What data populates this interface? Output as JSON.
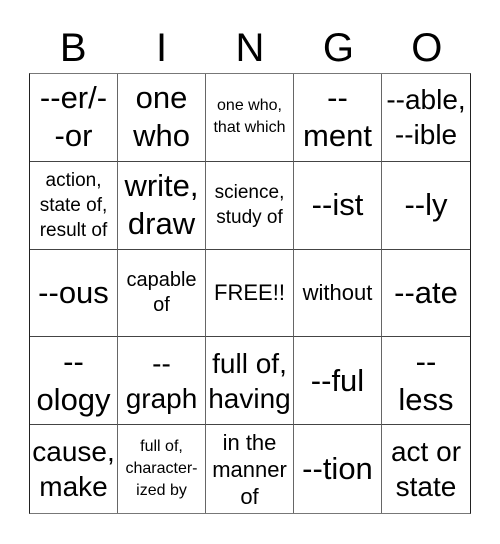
{
  "header": {
    "letters": [
      "B",
      "I",
      "N",
      "G",
      "O"
    ]
  },
  "cells": [
    {
      "text": "--er/-\n-or",
      "size": "s-xl"
    },
    {
      "text": "one\nwho",
      "size": "s-xl"
    },
    {
      "text": "one who,\nthat which",
      "size": "s-xs"
    },
    {
      "text": "--\nment",
      "size": "s-xl"
    },
    {
      "text": "--able,\n--ible",
      "size": "s-l"
    },
    {
      "text": "action,\nstate of,\nresult of",
      "size": "s-s"
    },
    {
      "text": "write,\ndraw",
      "size": "s-xl"
    },
    {
      "text": "science,\nstudy of",
      "size": "s-s"
    },
    {
      "text": "--ist",
      "size": "s-xl"
    },
    {
      "text": "--ly",
      "size": "s-xl"
    },
    {
      "text": "--ous",
      "size": "s-xl"
    },
    {
      "text": "capable\nof",
      "size": "s-ms"
    },
    {
      "text": "FREE!!",
      "size": "s-m"
    },
    {
      "text": "without",
      "size": "s-m"
    },
    {
      "text": "--ate",
      "size": "s-xl"
    },
    {
      "text": "--\nology",
      "size": "s-xl"
    },
    {
      "text": "--\ngraph",
      "size": "s-l"
    },
    {
      "text": "full of,\nhaving",
      "size": "s-l"
    },
    {
      "text": "--ful",
      "size": "s-xl"
    },
    {
      "text": "--\nless",
      "size": "s-xl"
    },
    {
      "text": "cause,\nmake",
      "size": "s-l"
    },
    {
      "text": "full of,\ncharacter-\nized by",
      "size": "s-xs"
    },
    {
      "text": "in the\nmanner\nof",
      "size": "s-m"
    },
    {
      "text": "--tion",
      "size": "s-xl"
    },
    {
      "text": "act or\nstate",
      "size": "s-l"
    }
  ]
}
